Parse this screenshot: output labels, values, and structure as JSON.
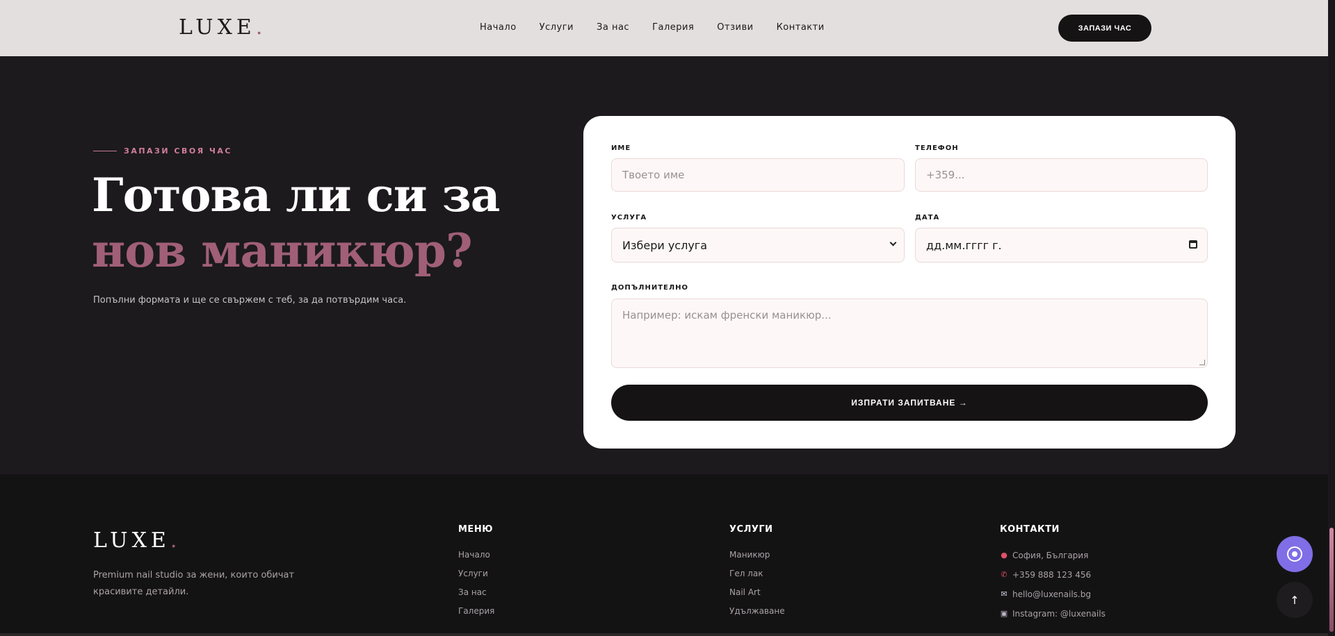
{
  "nav": {
    "logo": "LUXE",
    "logo_dot": ".",
    "items": [
      {
        "label": "Начало"
      },
      {
        "label": "Услуги"
      },
      {
        "label": "За нас"
      },
      {
        "label": "Галерия"
      },
      {
        "label": "Отзиви"
      },
      {
        "label": "Контакти"
      }
    ],
    "cta": "ЗАПАЗИ ЧАС"
  },
  "hero": {
    "eyebrow": "ЗАПАЗИ СВОЯ ЧАС",
    "title_line1": "Готова ли си за",
    "title_line2": "нов маникюр?",
    "lead": "Попълни формата и ще се свържем с теб, за да потвърдим часа."
  },
  "form": {
    "name_label": "ИМЕ",
    "name_placeholder": "Твоето име",
    "phone_label": "ТЕЛЕФОН",
    "phone_placeholder": "+359...",
    "service_label": "УСЛУГА",
    "service_value": "Избери услуга",
    "date_label": "ДАТА",
    "date_placeholder": "дд.мм.гггг г.",
    "extra_label": "ДОПЪЛНИТЕЛНО",
    "extra_placeholder": "Например: искам френски маникюр...",
    "submit": "ИЗПРАТИ ЗАПИТВАНЕ →"
  },
  "footer": {
    "logo": "LUXE",
    "logo_dot": ".",
    "description": "Premium nail studio за жени, които обичат красивите детайли.",
    "menu_title": "МЕНЮ",
    "menu": [
      {
        "label": "Начало"
      },
      {
        "label": "Услуги"
      },
      {
        "label": "За нас"
      },
      {
        "label": "Галерия"
      }
    ],
    "services_title": "УСЛУГИ",
    "services": [
      {
        "label": "Маникюр"
      },
      {
        "label": "Гел лак"
      },
      {
        "label": "Nail Art"
      },
      {
        "label": "Удължаване"
      }
    ],
    "contacts_title": "КОНТАКТИ",
    "contacts": [
      {
        "icon": "pin-icon",
        "label": "София, България"
      },
      {
        "icon": "phone-icon",
        "label": "+359 888 123 456"
      },
      {
        "icon": "mail-icon",
        "label": "hello@luxenails.bg"
      },
      {
        "icon": "instagram-icon",
        "label": "Instagram: @luxenails"
      }
    ]
  },
  "floating": {
    "scroll_top": "↑"
  },
  "colors": {
    "accent": "#a05f77",
    "accent_light": "#d27e9d",
    "dark": "#1c1a1c",
    "nav_bg": "#e4dfdf",
    "chat_fab": "#7f6ee6"
  }
}
